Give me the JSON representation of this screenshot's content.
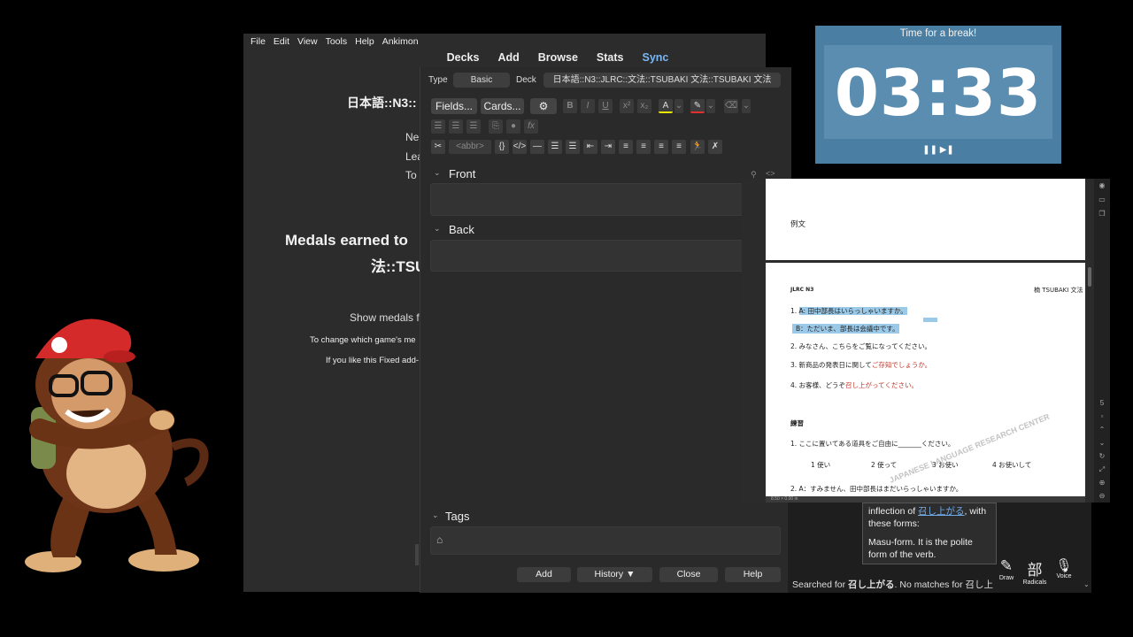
{
  "anki": {
    "menu": [
      "File",
      "Edit",
      "View",
      "Tools",
      "Help",
      "Ankimon"
    ],
    "toolbar": [
      "Decks",
      "Add",
      "Browse",
      "Stats",
      "Sync"
    ],
    "deck_title": "日本語::N3::",
    "stats": [
      "Ne",
      "Lea",
      "To"
    ],
    "medals_line1": "Medals earned to",
    "medals_line2": "法::TSU",
    "show_medals": "Show medals f",
    "change_game": "To change which game's me",
    "if_you_like": "If you like this Fixed add-"
  },
  "add_window": {
    "type_label": "Type",
    "type_value": "Basic",
    "deck_label": "Deck",
    "deck_value": "日本語::N3::JLRC::文法::TSUBAKI 文法::TSUBAKI 文法",
    "fields_button": "Fields...",
    "cards_button": "Cards...",
    "abbr": "<abbr>",
    "front_label": "Front",
    "back_label": "Back",
    "tags_label": "Tags",
    "buttons": [
      "Add",
      "History ▼",
      "Close",
      "Help"
    ]
  },
  "timer": {
    "title": "Time for a break!",
    "time": "03:33",
    "controls": "❚❚ ▶❚"
  },
  "pdf": {
    "page1_heading": "例文",
    "header_left": "JLRC N3",
    "header_right": "楠 TSUBAKI 文法",
    "line1a": "1. ",
    "line1b": "A: 田中部長はいらっしゃいますか。",
    "line2": "B：ただいま、部長は会議中です。",
    "line3": "2. みなさん、こちらをご覧になってください。",
    "line4a": "3. 新商品の発表日に関して",
    "line4b": "ご存知でしょうか。",
    "line5a": "4. お客様、どうぞ",
    "line5b": "召し上がってください。",
    "section2": "練習",
    "ex1": "1. ここに置いてある道具をご自由に_______ください。",
    "opts": [
      "1 使い",
      "2 使って",
      "3 お使い",
      "4 お使いして"
    ],
    "ex2": "2. A：すみません、田中部長はまだいらっしゃいますか。",
    "watermark": "JAPANESE LANGUAGE RESEARCH CENTER",
    "zoom": "8.50 × 0.00 in"
  },
  "dictionary": {
    "card_line1": "inflection of ",
    "card_link": "召し上がる",
    "card_line1b": ", with",
    "card_line2": "these forms:",
    "card_line3": "Masu-form. It is the polite",
    "card_line4": "form of the verb.",
    "status_prefix": "Searched for ",
    "status_term": "召し上がる",
    "status_suffix": ". No matches for ",
    "status_term2": "召し上",
    "tools": [
      {
        "icon": "✎",
        "label": "Draw"
      },
      {
        "icon": "部",
        "label": "Radicals"
      },
      {
        "icon": "🎙",
        "label": "Voice"
      }
    ]
  }
}
